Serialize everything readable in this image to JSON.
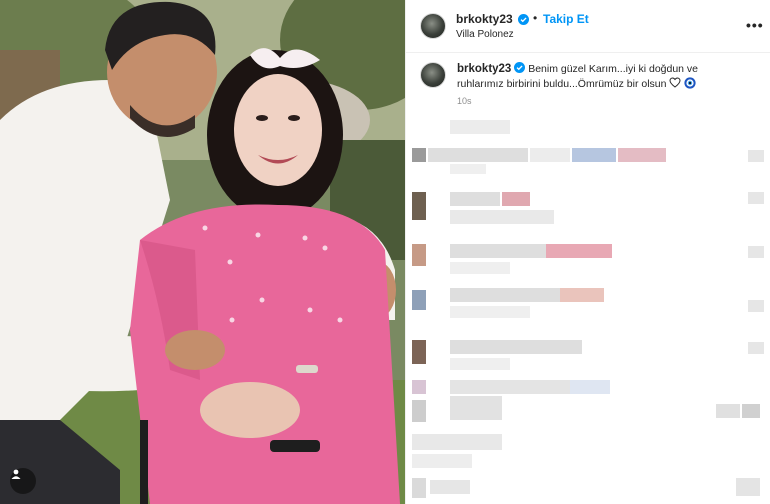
{
  "post": {
    "username": "brkokty23",
    "separator": "•",
    "follow_label": "Takip Et",
    "location": "Villa Polonez",
    "more_label": "•••"
  },
  "caption": {
    "username": "brkokty23",
    "text": "Benim güzel Karım...iyi ki doğdun ve ruhlarımız birbirini buldu...Ömrümüz bir olsun",
    "time": "10s"
  },
  "colors": {
    "accent": "#0095f6",
    "verified": "#0095f6",
    "top_blur": "#e2e2e2",
    "comment_blur": "#dedede"
  },
  "icons": [
    "verified-badge-icon",
    "more-options-icon",
    "heart-icon",
    "evil-eye-icon",
    "user-tag-icon"
  ],
  "comments_state": "blurred"
}
